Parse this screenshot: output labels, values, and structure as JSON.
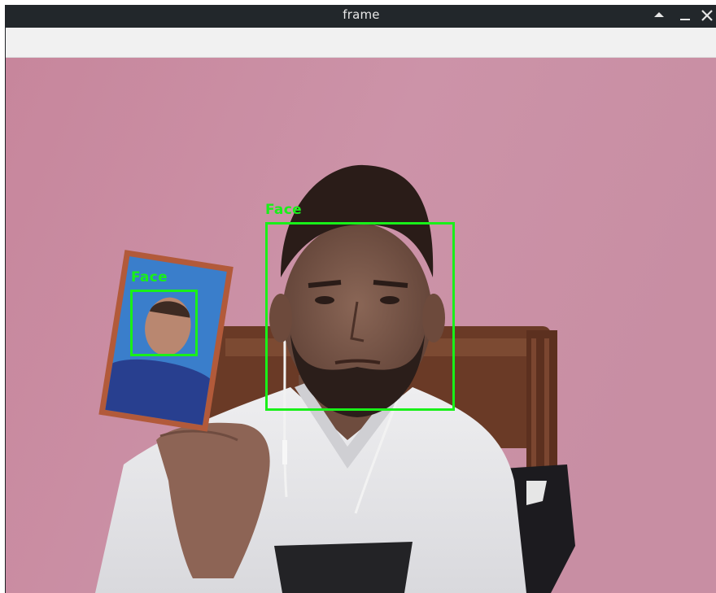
{
  "window": {
    "title": "frame",
    "controls": {
      "maximize_icon": "triangle-up-icon",
      "minimize_icon": "minimize-icon",
      "close_icon": "close-icon"
    }
  },
  "colors": {
    "titlebar": "#22272b",
    "detection_box": "#19f019",
    "wall": "#c98ea3"
  },
  "detections": [
    {
      "label": "Face"
    },
    {
      "label": "Face"
    }
  ]
}
